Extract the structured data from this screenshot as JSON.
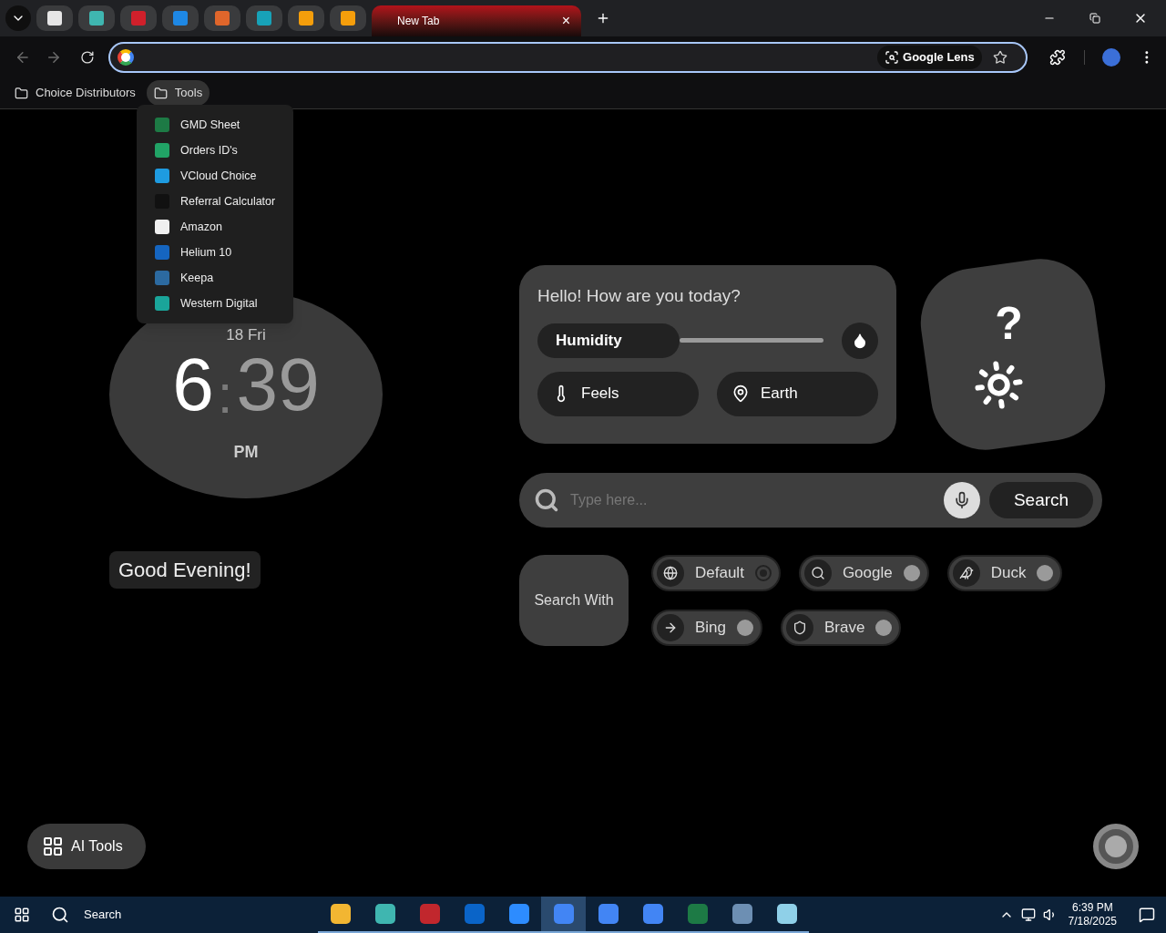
{
  "tabs": [
    {
      "kind": "favicon",
      "color": "#e6e6e6",
      "selected": false
    },
    {
      "kind": "favicon",
      "color": "#3fb6b0",
      "selected": false
    },
    {
      "kind": "favicon",
      "color": "#d0202b",
      "selected": false
    },
    {
      "kind": "favicon",
      "color": "#1e88e5",
      "selected": false
    },
    {
      "kind": "favicon",
      "color": "#e0662b",
      "selected": false
    },
    {
      "kind": "favicon",
      "color": "#17a2b8",
      "selected": false
    },
    {
      "kind": "favicon",
      "color": "#f59e0b",
      "selected": false
    },
    {
      "kind": "favicon",
      "color": "#f59e0b",
      "selected": false
    },
    {
      "kind": "titled",
      "title": "New Tab",
      "close": "×",
      "selected": true
    }
  ],
  "address_bar": {
    "lens_label": "Google Lens"
  },
  "bookmarks": [
    {
      "label": "Choice Distributors",
      "selected": false
    },
    {
      "label": "Tools",
      "selected": true
    }
  ],
  "tools_menu": [
    {
      "label": "GMD Sheet",
      "color": "#1d7a45"
    },
    {
      "label": "Orders ID's",
      "color": "#21a366"
    },
    {
      "label": "VCloud Choice",
      "color": "#1e9be0"
    },
    {
      "label": "Referral Calculator",
      "color": "#111111"
    },
    {
      "label": "Amazon",
      "color": "#f0f0f0"
    },
    {
      "label": "Helium 10",
      "color": "#1565c0"
    },
    {
      "label": "Keepa",
      "color": "#2c6aa0"
    },
    {
      "label": "Western Digital",
      "color": "#1aa59a"
    }
  ],
  "clock": {
    "date": "18 Fri",
    "hours": "6",
    "separator": ":",
    "minutes": "39",
    "period": "PM"
  },
  "greeting": "Good Evening!",
  "weather": {
    "title": "Hello! How are you today?",
    "humidity_label": "Humidity",
    "feels_label": "Feels",
    "location_label": "Earth",
    "condition": "?"
  },
  "search": {
    "placeholder": "Type here...",
    "button": "Search"
  },
  "search_with": {
    "label": "Search With",
    "engines": [
      {
        "label": "Default",
        "selected": true
      },
      {
        "label": "Google",
        "selected": false
      },
      {
        "label": "Duck",
        "selected": false
      },
      {
        "label": "Bing",
        "selected": false
      },
      {
        "label": "Brave",
        "selected": false
      }
    ]
  },
  "ai_tools": "AI Tools",
  "taskbar": {
    "search": "Search",
    "time": "6:39 PM",
    "date": "7/18/2025",
    "apps": [
      {
        "color": "#f2b632",
        "active": false
      },
      {
        "color": "#3fb6b0",
        "active": false
      },
      {
        "color": "#c1272d",
        "active": false
      },
      {
        "color": "#0a64c8",
        "active": false
      },
      {
        "color": "#2d8cff",
        "active": false
      },
      {
        "color": "#4285f4",
        "active": true
      },
      {
        "color": "#4285f4",
        "active": false
      },
      {
        "color": "#4285f4",
        "active": false
      },
      {
        "color": "#1d7a45",
        "active": false
      },
      {
        "color": "#6d8fb3",
        "active": false
      },
      {
        "color": "#8fd0e8",
        "active": false
      }
    ]
  }
}
